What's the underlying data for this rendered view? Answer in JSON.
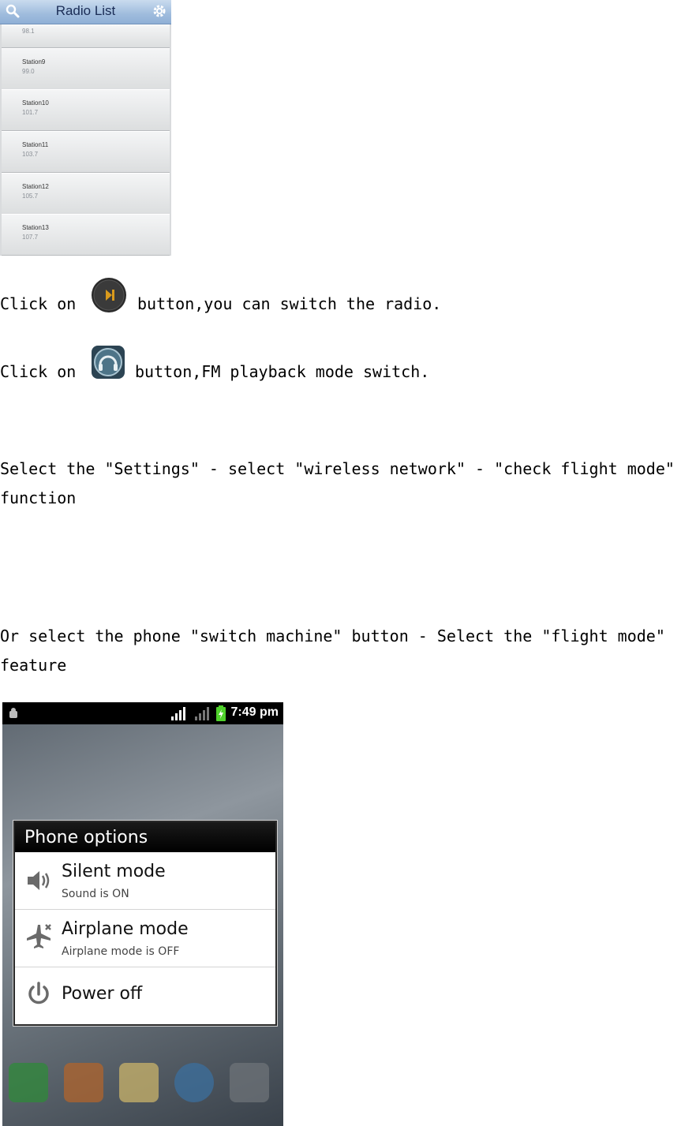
{
  "radio_list": {
    "title": "Radio List",
    "partial_row_freq": "98.1",
    "stations": [
      {
        "name": "Station9",
        "freq": "99.0"
      },
      {
        "name": "Station10",
        "freq": "101.7"
      },
      {
        "name": "Station11",
        "freq": "103.7"
      },
      {
        "name": "Station12",
        "freq": "105.7"
      },
      {
        "name": "Station13",
        "freq": "107.7"
      }
    ]
  },
  "instructions": {
    "line1_before": "Click on",
    "line1_after": "button,you can switch the radio.",
    "line2_before": "Click on",
    "line2_after": "button,FM playback mode switch.",
    "para1_line1": "Select the \"Settings\" - select \"wireless network\" - \"check flight mode\"",
    "para1_line2": "function",
    "para2_line1": "Or select the phone \"switch machine\" button - Select the \"flight mode\"",
    "para2_line2": "feature"
  },
  "phone": {
    "status_time": "7:49 pm",
    "dialog_title": "Phone options",
    "options": [
      {
        "title": "Silent mode",
        "subtitle": "Sound is ON",
        "icon": "speaker-icon"
      },
      {
        "title": "Airplane mode",
        "subtitle": "Airplane mode is OFF",
        "icon": "airplane-icon"
      },
      {
        "title": "Power off",
        "subtitle": "",
        "icon": "power-icon"
      }
    ]
  },
  "colors": {
    "play_button": "#d99a1c",
    "headphone_button": "#3c5f73"
  }
}
